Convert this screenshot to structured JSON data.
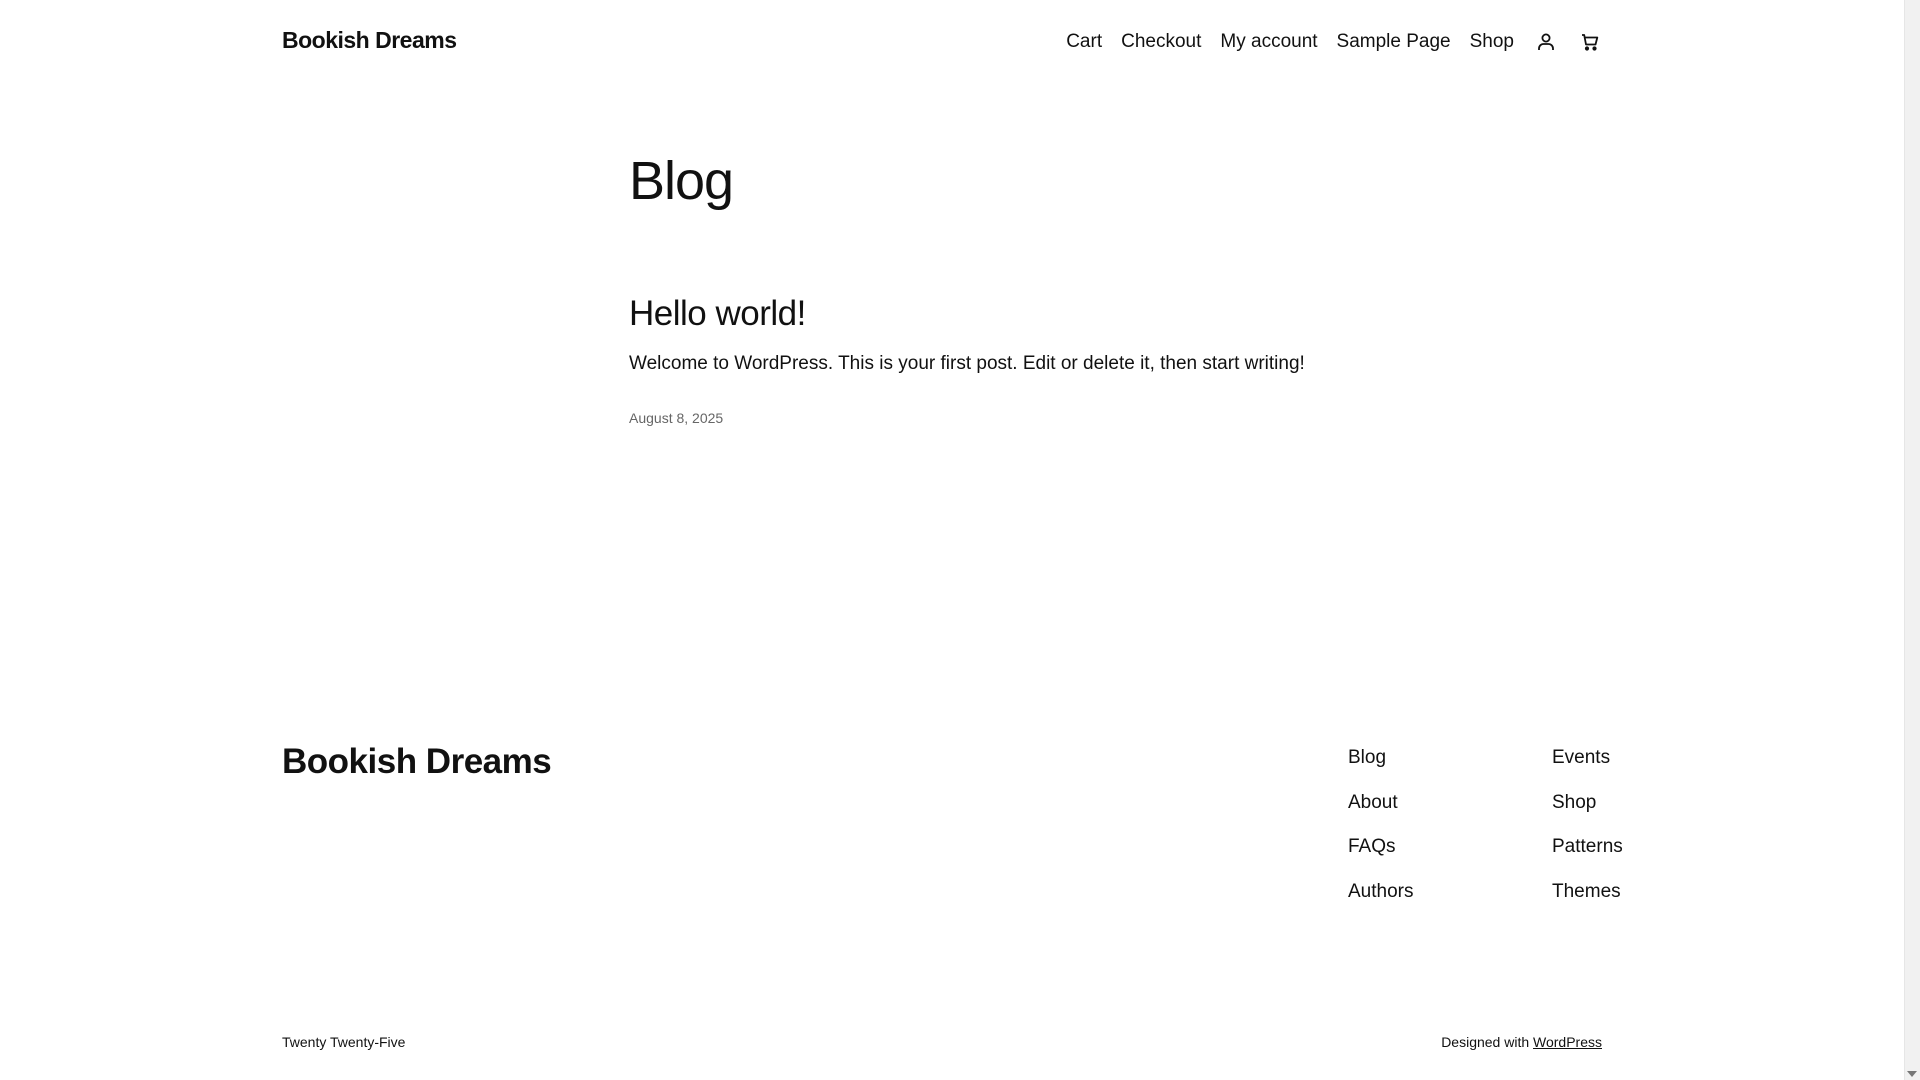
{
  "header": {
    "site_title": "Bookish Dreams",
    "nav": [
      "Cart",
      "Checkout",
      "My account",
      "Sample Page",
      "Shop"
    ],
    "icons": [
      "account-icon",
      "cart-icon"
    ]
  },
  "main": {
    "title": "Blog",
    "post": {
      "title": "Hello world!",
      "excerpt": "Welcome to WordPress. This is your first post. Edit or delete it, then start writing!",
      "date": "August 8, 2025"
    }
  },
  "footer": {
    "title": "Bookish Dreams",
    "col1": [
      "Blog",
      "About",
      "FAQs",
      "Authors"
    ],
    "col2": [
      "Events",
      "Shop",
      "Patterns",
      "Themes"
    ],
    "credits_left": "Twenty Twenty-Five",
    "credits_prefix": "Designed with",
    "credits_link": "WordPress"
  }
}
